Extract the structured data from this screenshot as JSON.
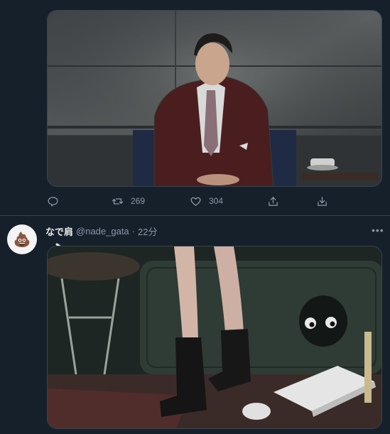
{
  "tweet1": {
    "actions": {
      "reply_count": "",
      "retweet_count": "269",
      "like_count": "304"
    }
  },
  "tweet2": {
    "author_name": "なで肩",
    "author_handle": "@nade_gata",
    "separator": "·",
    "time": "22分",
    "avatar_icon": "pile-of-poo-icon",
    "more_icon": "more-icon"
  },
  "colors": {
    "background": "#15202b",
    "divider": "#38444d",
    "muted": "#8b98a5",
    "text": "#e7e9ea"
  }
}
